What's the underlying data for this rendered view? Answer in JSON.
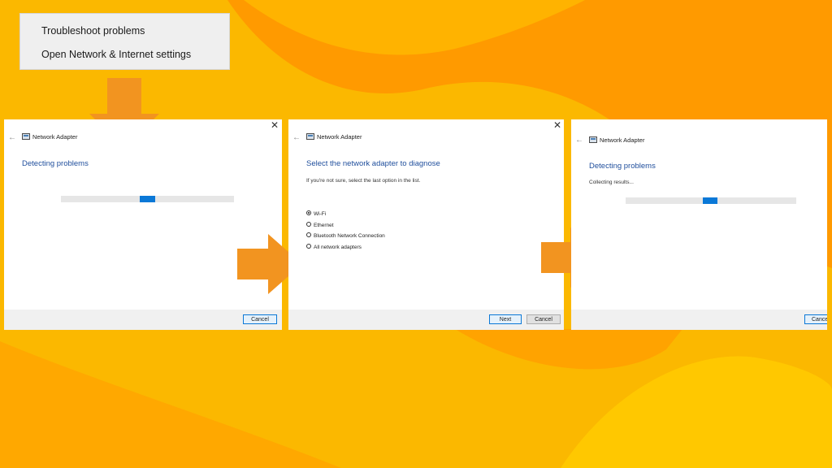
{
  "colors": {
    "background": "#fbb800",
    "blob_dark": "#ff9a00",
    "blob_light": "#ffc600",
    "arrow": "#f29420",
    "accent": "#0a78d7",
    "heading": "#1f4e9c"
  },
  "context_menu": {
    "items": [
      "Troubleshoot problems",
      "Open Network & Internet settings"
    ]
  },
  "dialog1": {
    "window_title": "Network Adapter",
    "heading": "Detecting problems",
    "progress_fraction": 0.09,
    "cancel_label": "Cancel",
    "close_glyph": "✕",
    "back_glyph": "←"
  },
  "dialog2": {
    "window_title": "Network Adapter",
    "heading": "Select the network adapter to diagnose",
    "subtext": "If you're not sure, select the last option in the list.",
    "options": [
      {
        "label": "Wi-Fi",
        "selected": true
      },
      {
        "label": "Ethernet",
        "selected": false
      },
      {
        "label": "Bluetooth Network Connection",
        "selected": false
      },
      {
        "label": "All network adapters",
        "selected": false
      }
    ],
    "next_label": "Next",
    "cancel_label": "Cancel",
    "close_glyph": "✕",
    "back_glyph": "←"
  },
  "dialog3": {
    "window_title": "Network Adapter",
    "heading": "Detecting problems",
    "subtext": "Collecting results...",
    "progress_fraction": 0.09,
    "cancel_label": "Cance",
    "back_glyph": "←"
  },
  "icons": [
    "down-arrow-icon",
    "right-arrow-icon",
    "network-adapter-icon",
    "back-arrow-icon",
    "close-icon",
    "radio-icon"
  ]
}
